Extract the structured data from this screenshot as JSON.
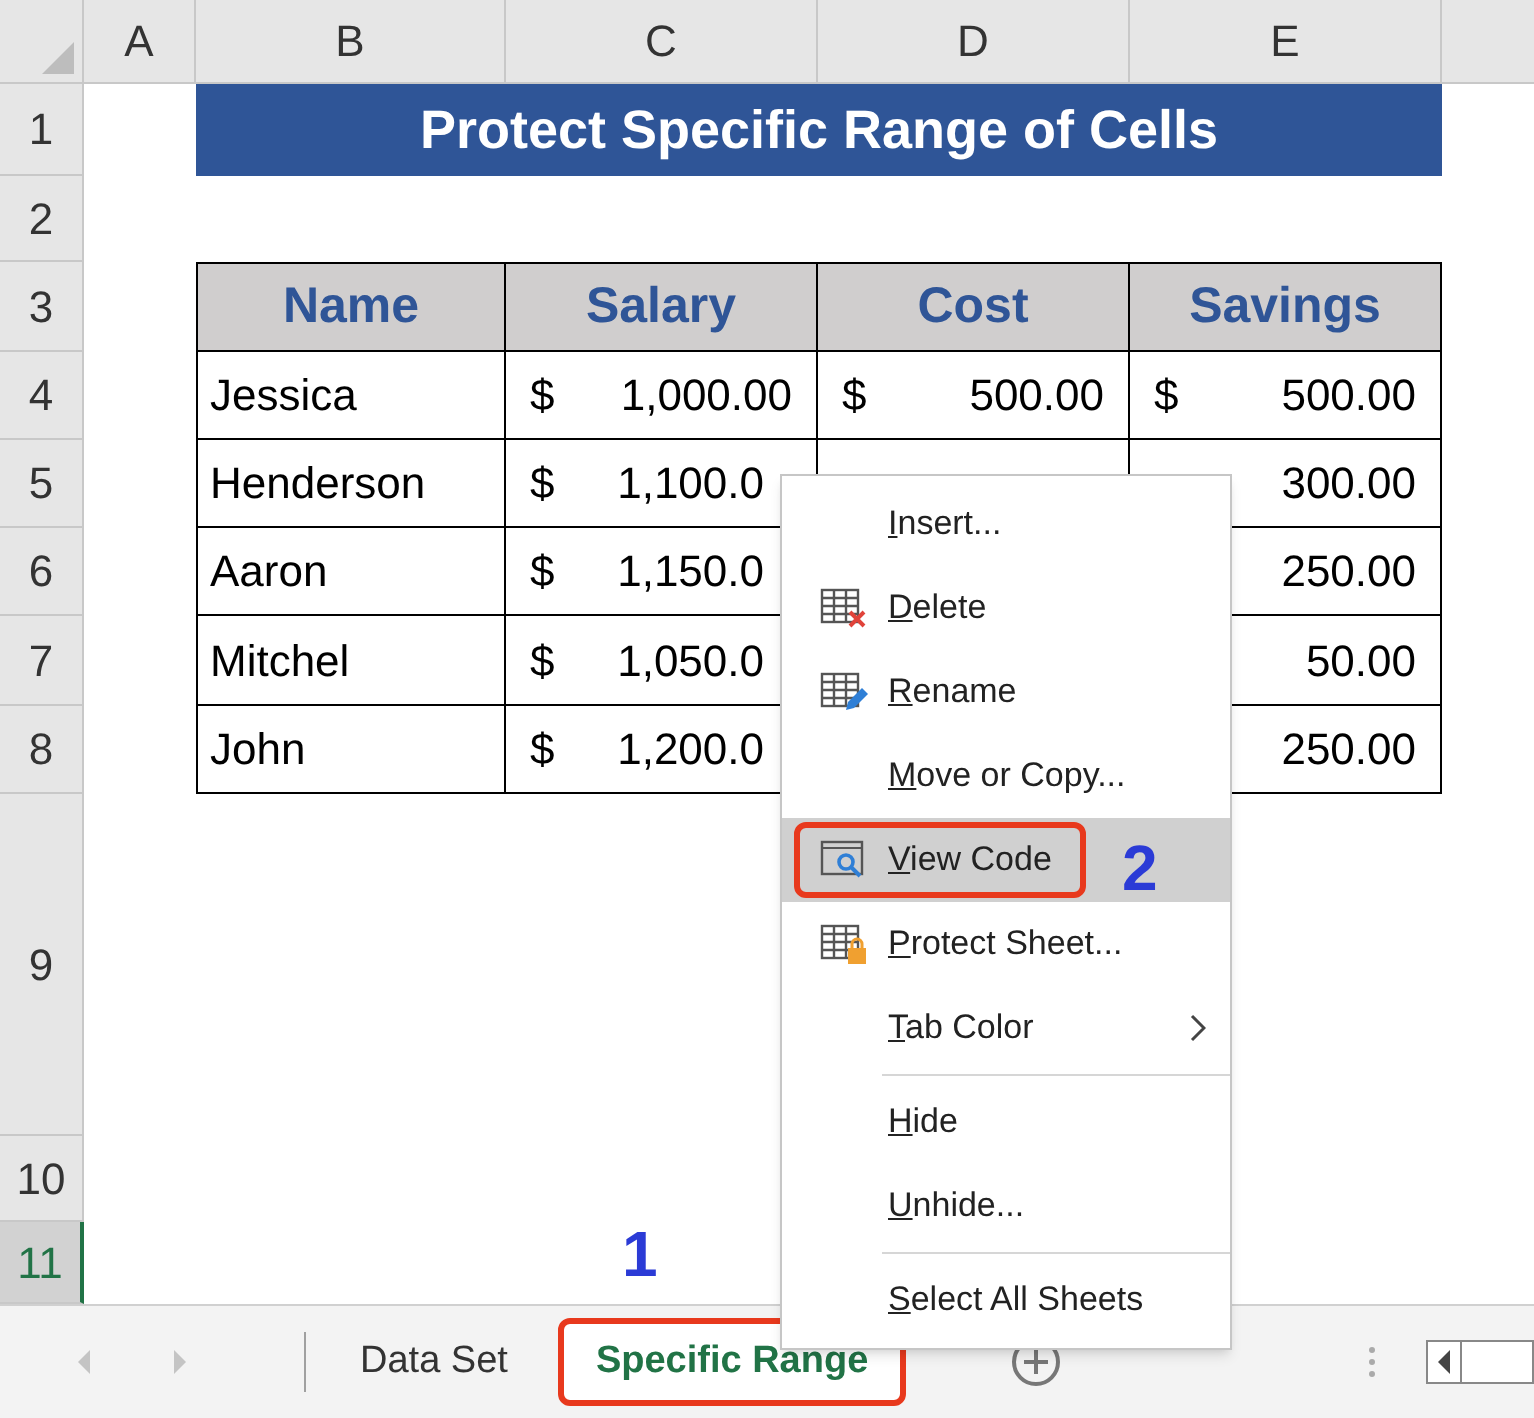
{
  "column_headers": [
    "A",
    "B",
    "C",
    "D",
    "E"
  ],
  "row_headers": [
    {
      "label": "1",
      "selected": false
    },
    {
      "label": "2",
      "selected": false
    },
    {
      "label": "3",
      "selected": false
    },
    {
      "label": "4",
      "selected": false
    },
    {
      "label": "5",
      "selected": false
    },
    {
      "label": "6",
      "selected": false
    },
    {
      "label": "7",
      "selected": false
    },
    {
      "label": "8",
      "selected": false
    },
    {
      "label": "9",
      "selected": false
    },
    {
      "label": "10",
      "selected": false
    },
    {
      "label": "11",
      "selected": true
    }
  ],
  "title": "Protect Specific Range of Cells",
  "table": {
    "columns": [
      "Name",
      "Salary",
      "Cost",
      "Savings"
    ],
    "rows": [
      {
        "name": "Jessica",
        "salary": {
          "currency": "$",
          "amount": "1,000.00"
        },
        "cost": {
          "currency": "$",
          "amount": "500.00"
        },
        "savings": {
          "currency": "$",
          "amount": "500.00"
        }
      },
      {
        "name": "Henderson",
        "salary": {
          "currency": "$",
          "amount": "1,100.0"
        },
        "cost": {},
        "savings": {
          "amount": "300.00"
        }
      },
      {
        "name": "Aaron",
        "salary": {
          "currency": "$",
          "amount": "1,150.0"
        },
        "cost": {},
        "savings": {
          "amount": "250.00"
        }
      },
      {
        "name": "Mitchel",
        "salary": {
          "currency": "$",
          "amount": "1,050.0"
        },
        "cost": {},
        "savings": {
          "amount": "50.00"
        }
      },
      {
        "name": "John",
        "salary": {
          "currency": "$",
          "amount": "1,200.0"
        },
        "cost": {},
        "savings": {
          "amount": "250.00"
        }
      }
    ]
  },
  "context_menu": [
    {
      "kind": "item",
      "label": "Insert...",
      "selected": false
    },
    {
      "kind": "item",
      "label": "Delete",
      "selected": false
    },
    {
      "kind": "item",
      "label": "Rename",
      "selected": false
    },
    {
      "kind": "item",
      "label": "Move or Copy...",
      "selected": false
    },
    {
      "kind": "item",
      "label": "View Code",
      "selected": true,
      "highlighted": true,
      "callout": "2"
    },
    {
      "kind": "item",
      "label": "Protect Sheet...",
      "selected": false
    },
    {
      "kind": "item",
      "label": "Tab Color",
      "selected": false,
      "submenu": true
    },
    {
      "kind": "separator"
    },
    {
      "kind": "item",
      "label": "Hide",
      "selected": false
    },
    {
      "kind": "item",
      "label": "Unhide...",
      "selected": false
    },
    {
      "kind": "separator"
    },
    {
      "kind": "item",
      "label": "Select All Sheets",
      "selected": false
    }
  ],
  "sheet_tabs": [
    {
      "label": "Data Set",
      "selected": false,
      "highlighted": false
    },
    {
      "label": "Specific Range",
      "selected": true,
      "highlighted": true,
      "callout": "1"
    }
  ]
}
